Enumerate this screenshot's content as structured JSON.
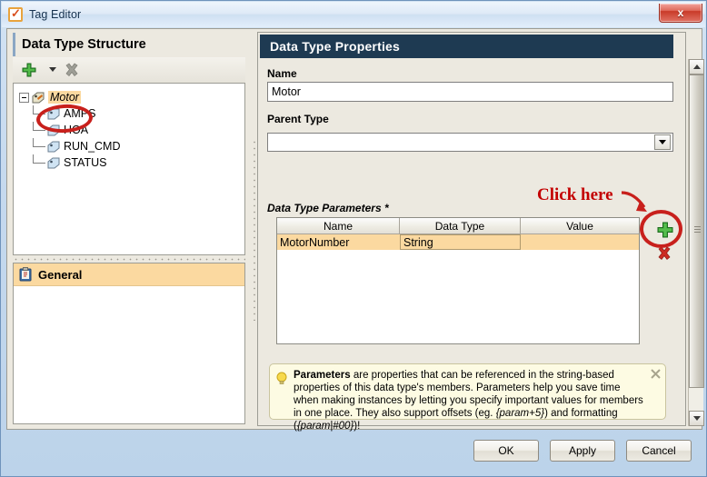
{
  "window": {
    "title": "Tag Editor",
    "app_icon": "checkbox-check-icon",
    "close_label": "x"
  },
  "left_panel": {
    "header": "Data Type Structure",
    "toolbar": {
      "add_label": "+",
      "dropdown_label": "",
      "delete_label": "x"
    },
    "tree": {
      "root": {
        "label": "Motor",
        "expander": "-"
      },
      "children": [
        {
          "label": "AMPS"
        },
        {
          "label": "HOA"
        },
        {
          "label": "RUN_CMD"
        },
        {
          "label": "STATUS"
        }
      ]
    },
    "general_list": [
      {
        "label": "General"
      }
    ]
  },
  "right_panel": {
    "header": "Data Type Properties",
    "name_label": "Name",
    "name_value": "Motor",
    "name_placeholder": "",
    "parent_label": "Parent Type",
    "parent_value": "",
    "parent_placeholder": "",
    "parameters_label": "Data Type Parameters *",
    "table": {
      "columns": [
        "Name",
        "Data Type",
        "Value"
      ],
      "rows": [
        {
          "name": "MotorNumber",
          "data_type": "String",
          "value": ""
        }
      ]
    },
    "buttons": {
      "add_param": "+",
      "delete_param": "x"
    },
    "info": {
      "icon": "lightbulb-icon",
      "close": "x",
      "lead": "Parameters",
      "body_1": " are properties that can be referenced in the string-based properties of this data type's members. Parameters help you save time when making instances by letting you specify important values for members in one place. They also support offsets (eg. ",
      "em_1": "{param+5}",
      "body_2": ") and formatting (",
      "em_2": "{param|#00}",
      "body_3": ")!"
    }
  },
  "annotations": {
    "click_here": "Click here",
    "highlight_color": "#c8201c"
  },
  "footer": {
    "buttons": [
      {
        "label": "OK"
      },
      {
        "label": "Apply"
      },
      {
        "label": "Cancel"
      }
    ]
  }
}
